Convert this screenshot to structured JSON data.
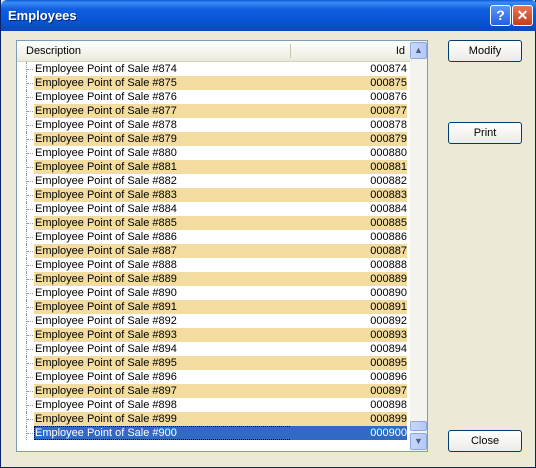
{
  "window": {
    "title": "Employees",
    "help_glyph": "?",
    "close_glyph": "✕"
  },
  "list": {
    "columns": {
      "description": "Description",
      "id": "Id"
    },
    "rows": [
      {
        "desc": "Employee Point of Sale #874",
        "id": "000874"
      },
      {
        "desc": "Employee Point of Sale #875",
        "id": "000875"
      },
      {
        "desc": "Employee Point of Sale #876",
        "id": "000876"
      },
      {
        "desc": "Employee Point of Sale #877",
        "id": "000877"
      },
      {
        "desc": "Employee Point of Sale #878",
        "id": "000878"
      },
      {
        "desc": "Employee Point of Sale #879",
        "id": "000879"
      },
      {
        "desc": "Employee Point of Sale #880",
        "id": "000880"
      },
      {
        "desc": "Employee Point of Sale #881",
        "id": "000881"
      },
      {
        "desc": "Employee Point of Sale #882",
        "id": "000882"
      },
      {
        "desc": "Employee Point of Sale #883",
        "id": "000883"
      },
      {
        "desc": "Employee Point of Sale #884",
        "id": "000884"
      },
      {
        "desc": "Employee Point of Sale #885",
        "id": "000885"
      },
      {
        "desc": "Employee Point of Sale #886",
        "id": "000886"
      },
      {
        "desc": "Employee Point of Sale #887",
        "id": "000887"
      },
      {
        "desc": "Employee Point of Sale #888",
        "id": "000888"
      },
      {
        "desc": "Employee Point of Sale #889",
        "id": "000889"
      },
      {
        "desc": "Employee Point of Sale #890",
        "id": "000890"
      },
      {
        "desc": "Employee Point of Sale #891",
        "id": "000891"
      },
      {
        "desc": "Employee Point of Sale #892",
        "id": "000892"
      },
      {
        "desc": "Employee Point of Sale #893",
        "id": "000893"
      },
      {
        "desc": "Employee Point of Sale #894",
        "id": "000894"
      },
      {
        "desc": "Employee Point of Sale #895",
        "id": "000895"
      },
      {
        "desc": "Employee Point of Sale #896",
        "id": "000896"
      },
      {
        "desc": "Employee Point of Sale #897",
        "id": "000897"
      },
      {
        "desc": "Employee Point of Sale #898",
        "id": "000898"
      },
      {
        "desc": "Employee Point of Sale #899",
        "id": "000899"
      },
      {
        "desc": "Employee Point of Sale #900",
        "id": "000900"
      }
    ],
    "selected_id": "000900"
  },
  "scrollbar": {
    "up_glyph": "▲",
    "down_glyph": "▼"
  },
  "buttons": {
    "modify": "Modify",
    "print": "Print",
    "close": "Close"
  },
  "colors": {
    "alt_row": "#f3dca0",
    "selection": "#316ac5",
    "title_bar": "#0854d4"
  }
}
